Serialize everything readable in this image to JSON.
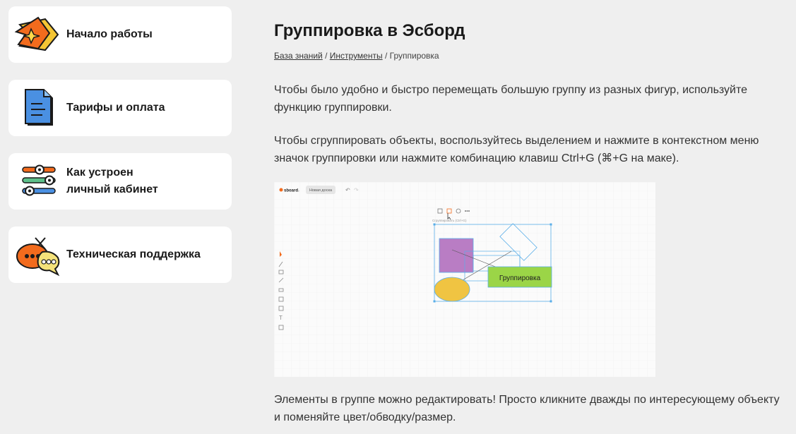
{
  "sidebar": {
    "items": [
      {
        "label": "Начало работы",
        "icon": "rocket-icon"
      },
      {
        "label": "Тарифы и оплата",
        "icon": "document-icon"
      },
      {
        "label": "Как устроен\nличный кабинет",
        "icon": "sliders-icon"
      },
      {
        "label": "Техническая поддержка",
        "icon": "chat-bubbles-icon"
      }
    ]
  },
  "article": {
    "title": "Группировка в Эсборд",
    "breadcrumb": {
      "items": [
        "База знаний",
        "Инструменты",
        "Группировка"
      ],
      "separator": " / "
    },
    "paragraphs": [
      "Чтобы было удобно и быстро перемещать большую группу из разных фигур, используйте функцию группировки.",
      "Чтобы сгруппировать объекты, воспользуйтесь выделением и нажмите в контекстном меню значок группировки или нажмите комбинацию клавиш Ctrl+G (⌘+G на маке).",
      "Элементы в группе можно редактировать! Просто кликните дважды по интересующему объекту и поменяйте цвет/обводку/размер."
    ],
    "screenshot": {
      "app_logo": "sboard",
      "board_button": "Новая доска",
      "tooltip": "Сгруппировать (Ctrl+G)",
      "shape_label": "Группировка"
    }
  },
  "colors": {
    "background": "#efefef",
    "card": "#ffffff",
    "accent_orange": "#f26b1d",
    "purple_shape": "#b97dc4",
    "green_shape": "#9bd547",
    "yellow_shape": "#f0c442",
    "selection_blue": "#5aaee8"
  }
}
